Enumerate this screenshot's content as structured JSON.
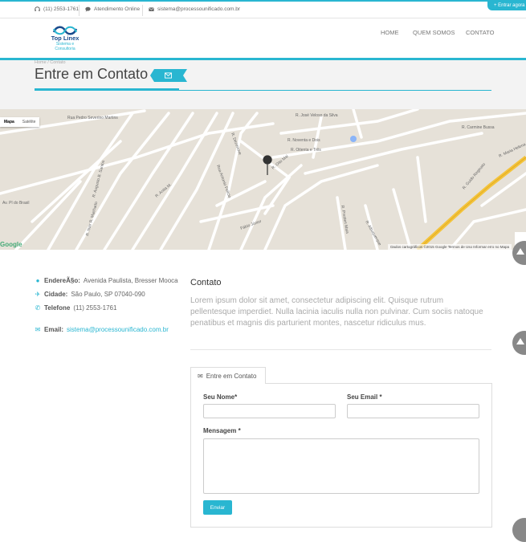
{
  "topbar": {
    "phone": "(11) 2553-1761",
    "online": "Atendimento Online",
    "email": "sistema@processounificado.com.br",
    "login": "+ Entrar agora"
  },
  "logo": {
    "line1": "Top Linex",
    "line2": "Sistema e Consultoria"
  },
  "nav": {
    "home": "HOME",
    "about": "QUEM SOMOS",
    "contact": "CONTATO"
  },
  "page": {
    "breadcrumb": "Home / Contato",
    "title": "Entre em Contato"
  },
  "map": {
    "tab_map": "Mapa",
    "tab_sat": "Satélite",
    "footer": "Dados cartográficos ©2015 Google   Termos de Uso   Informar erro no Mapa",
    "google": "Google",
    "labels": [
      "Rua Pedro Severino Martins",
      "R. José Veloso da Silva",
      "R. Carmine Bussa",
      "R. Dezenove",
      "R. Oitenta e Três",
      "R. Noventa e Dois",
      "Av. Pl do Brasil",
      "R. Nair R. Machado",
      "R. Augusto B. Santos",
      "R. Anita M.",
      "R. Maria Helena",
      "R. Guido Reginato",
      "R. Prestes Maia",
      "R. Albuquerque",
      "Rua Antonio Felício",
      "Fábio Júnior",
      "R. Oito Mai"
    ]
  },
  "info": {
    "address_label": "EndereÃ§o:",
    "address": "Avenida Paulista, Bresser Mooca",
    "city_label": "Cidade:",
    "city": "São Paulo, SP 07040-090",
    "phone_label": "Telefone",
    "phone": "(11) 2553-1761",
    "email_label": "Email:",
    "email": "sistema@processounificado.com.br"
  },
  "contact": {
    "heading": "Contato",
    "body": "Lorem ipsum dolor sit amet, consectetur adipiscing elit. Quisque rutrum pellentesque imperdiet. Nulla lacinia iaculis nulla non pulvinar. Cum sociis natoque penatibus et magnis dis parturient montes, nascetur ridiculus mus."
  },
  "form": {
    "tab": "Entre em Contato",
    "name_label": "Seu Nome*",
    "email_label": "Seu Email *",
    "message_label": "Mensagem *",
    "send": "Enviar"
  },
  "colors": {
    "accent": "#29b6d1",
    "brand_dark": "#1a4b8c"
  }
}
